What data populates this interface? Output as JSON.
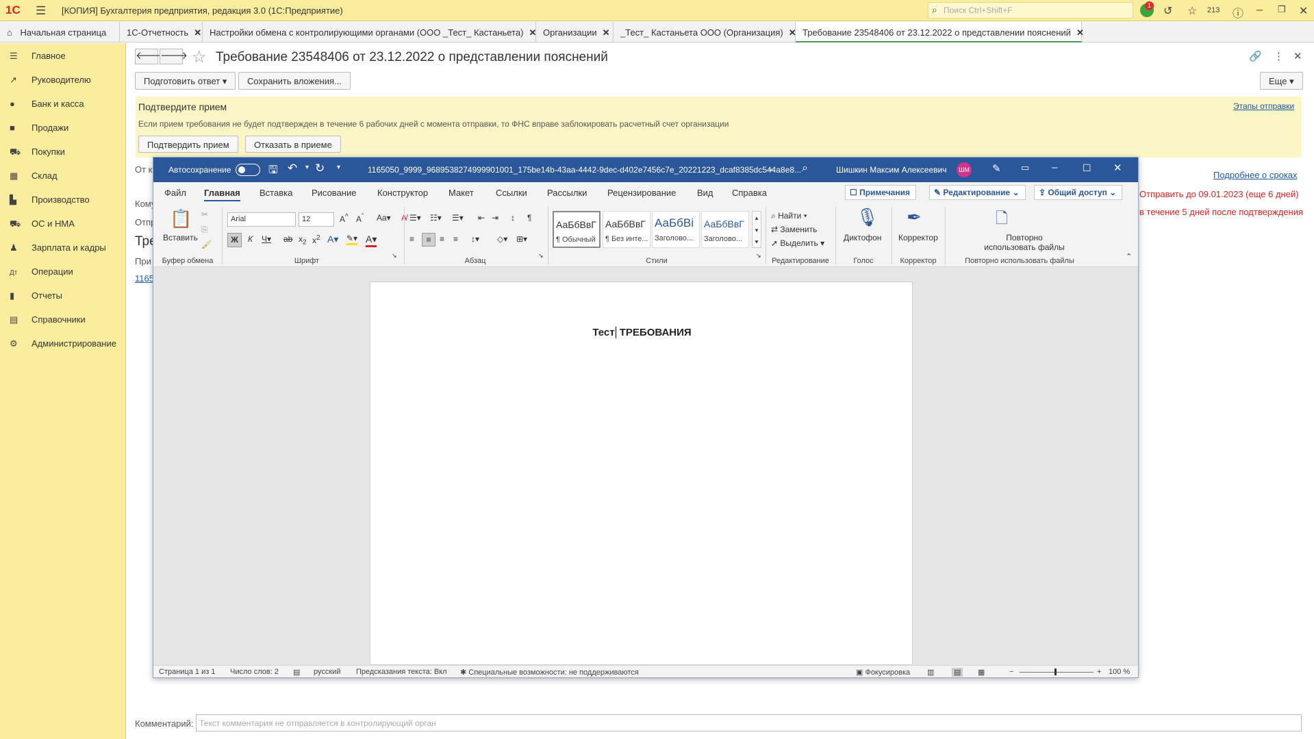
{
  "app": {
    "logo": "1С",
    "title": "[КОПИЯ] Бухгалтерия предприятия, редакция 3.0  (1С:Предприятие)",
    "search_placeholder": "Поиск Ctrl+Shift+F",
    "notif_count": "1",
    "history_count": "213"
  },
  "tabs": [
    {
      "label": "Начальная страница"
    },
    {
      "label": "1С-Отчетность"
    },
    {
      "label": "Настройки обмена с контролирующими органами (ООО _Тест_ Кастаньета)"
    },
    {
      "label": "Организации"
    },
    {
      "label": "_Тест_ Кастаньета ООО (Организация)"
    },
    {
      "label": "Требование 23548406 от 23.12.2022 о представлении пояснений"
    }
  ],
  "sidebar": {
    "items": [
      {
        "label": "Главное",
        "icon": "menu-icon"
      },
      {
        "label": "Руководителю",
        "icon": "chart-trend-icon"
      },
      {
        "label": "Банк и касса",
        "icon": "coin-icon"
      },
      {
        "label": "Продажи",
        "icon": "bag-icon"
      },
      {
        "label": "Покупки",
        "icon": "cart-icon"
      },
      {
        "label": "Склад",
        "icon": "grid-icon"
      },
      {
        "label": "Производство",
        "icon": "factory-icon"
      },
      {
        "label": "ОС и НМА",
        "icon": "truck-icon"
      },
      {
        "label": "Зарплата и кадры",
        "icon": "person-icon"
      },
      {
        "label": "Операции",
        "icon": "dt-kt-icon"
      },
      {
        "label": "Отчеты",
        "icon": "bar-chart-icon"
      },
      {
        "label": "Справочники",
        "icon": "book-icon"
      },
      {
        "label": "Администрирование",
        "icon": "gear-icon"
      }
    ]
  },
  "document": {
    "title": "Требование 23548406 от 23.12.2022 о представлении пояснений",
    "prepare_reply": "Подготовить ответ",
    "save_attachments": "Сохранить вложения...",
    "more": "Еще",
    "notice_title": "Подтвердите прием",
    "notice_text": "Если прием требования не будет подтвержден в течение 6 рабочих дней с момента отправки, то ФНС вправе заблокировать расчетный счет организации",
    "stages_link": "Этапы отправки",
    "confirm_button": "Подтвердить прием",
    "reject_button": "Отказать в приеме",
    "from_label": "От к",
    "deadline_link": "Подробнее о сроках",
    "send_until": "Отправить до 09.01.2023 (еще 6 дней)",
    "within_days": "в течение 5 дней после подтверждения",
    "label_komu": "Кому",
    "label_otpr": "Отпр",
    "section_tre": "Тре",
    "label_pri": "При",
    "attach_link": "1165",
    "comment_label": "Комментарий:",
    "comment_placeholder": "Текст комментария не отправляется в контролирующий орган"
  },
  "word": {
    "autosave": "Автосохранение",
    "filename": "1165050_9999_9689538274999901001_175be14b-43aa-4442-9dec-d402e7456c7e_20221223_dcaf8385dc544a8e8...",
    "user": "Шишкин Максим Алексеевич",
    "user_initials": "ШМ",
    "ribbon_tabs": [
      "Файл",
      "Главная",
      "Вставка",
      "Рисование",
      "Конструктор",
      "Макет",
      "Ссылки",
      "Рассылки",
      "Рецензирование",
      "Вид",
      "Справка"
    ],
    "comments_btn": "Примечания",
    "editing_btn": "Редактирование",
    "share_btn": "Общий доступ",
    "paste": "Вставить",
    "font_name": "Arial",
    "font_size": "12",
    "groups": {
      "clipboard": "Буфер обмена",
      "font": "Шрифт",
      "paragraph": "Абзац",
      "styles": "Стили",
      "editing": "Редактирование",
      "voice": "Голос",
      "editor": "Корректор",
      "reuse": "Повторно использовать файлы"
    },
    "styles": [
      {
        "preview": "АаБбВвГ",
        "name": "¶ Обычный"
      },
      {
        "preview": "АаБбВвГ",
        "name": "¶ Без инте..."
      },
      {
        "preview": "АаБбВі",
        "name": "Заголово..."
      },
      {
        "preview": "АаБбВвГ",
        "name": "Заголово..."
      }
    ],
    "find": "Найти",
    "replace": "Заменить",
    "select": "Выделить",
    "dictation": "Диктофон",
    "editor": "Корректор",
    "reuse_line1": "Повторно",
    "reuse_line2": "использовать файлы",
    "doc_text_part1": "Тест",
    "doc_text_part2": "ТРЕБОВАНИЯ",
    "status": {
      "page": "Страница 1 из 1",
      "words": "Число слов: 2",
      "lang": "русский",
      "predict": "Предсказания текста: Вкл",
      "access": "Специальные возможности: не поддерживаются",
      "focus": "Фокусировка",
      "zoom": "100 %"
    }
  }
}
